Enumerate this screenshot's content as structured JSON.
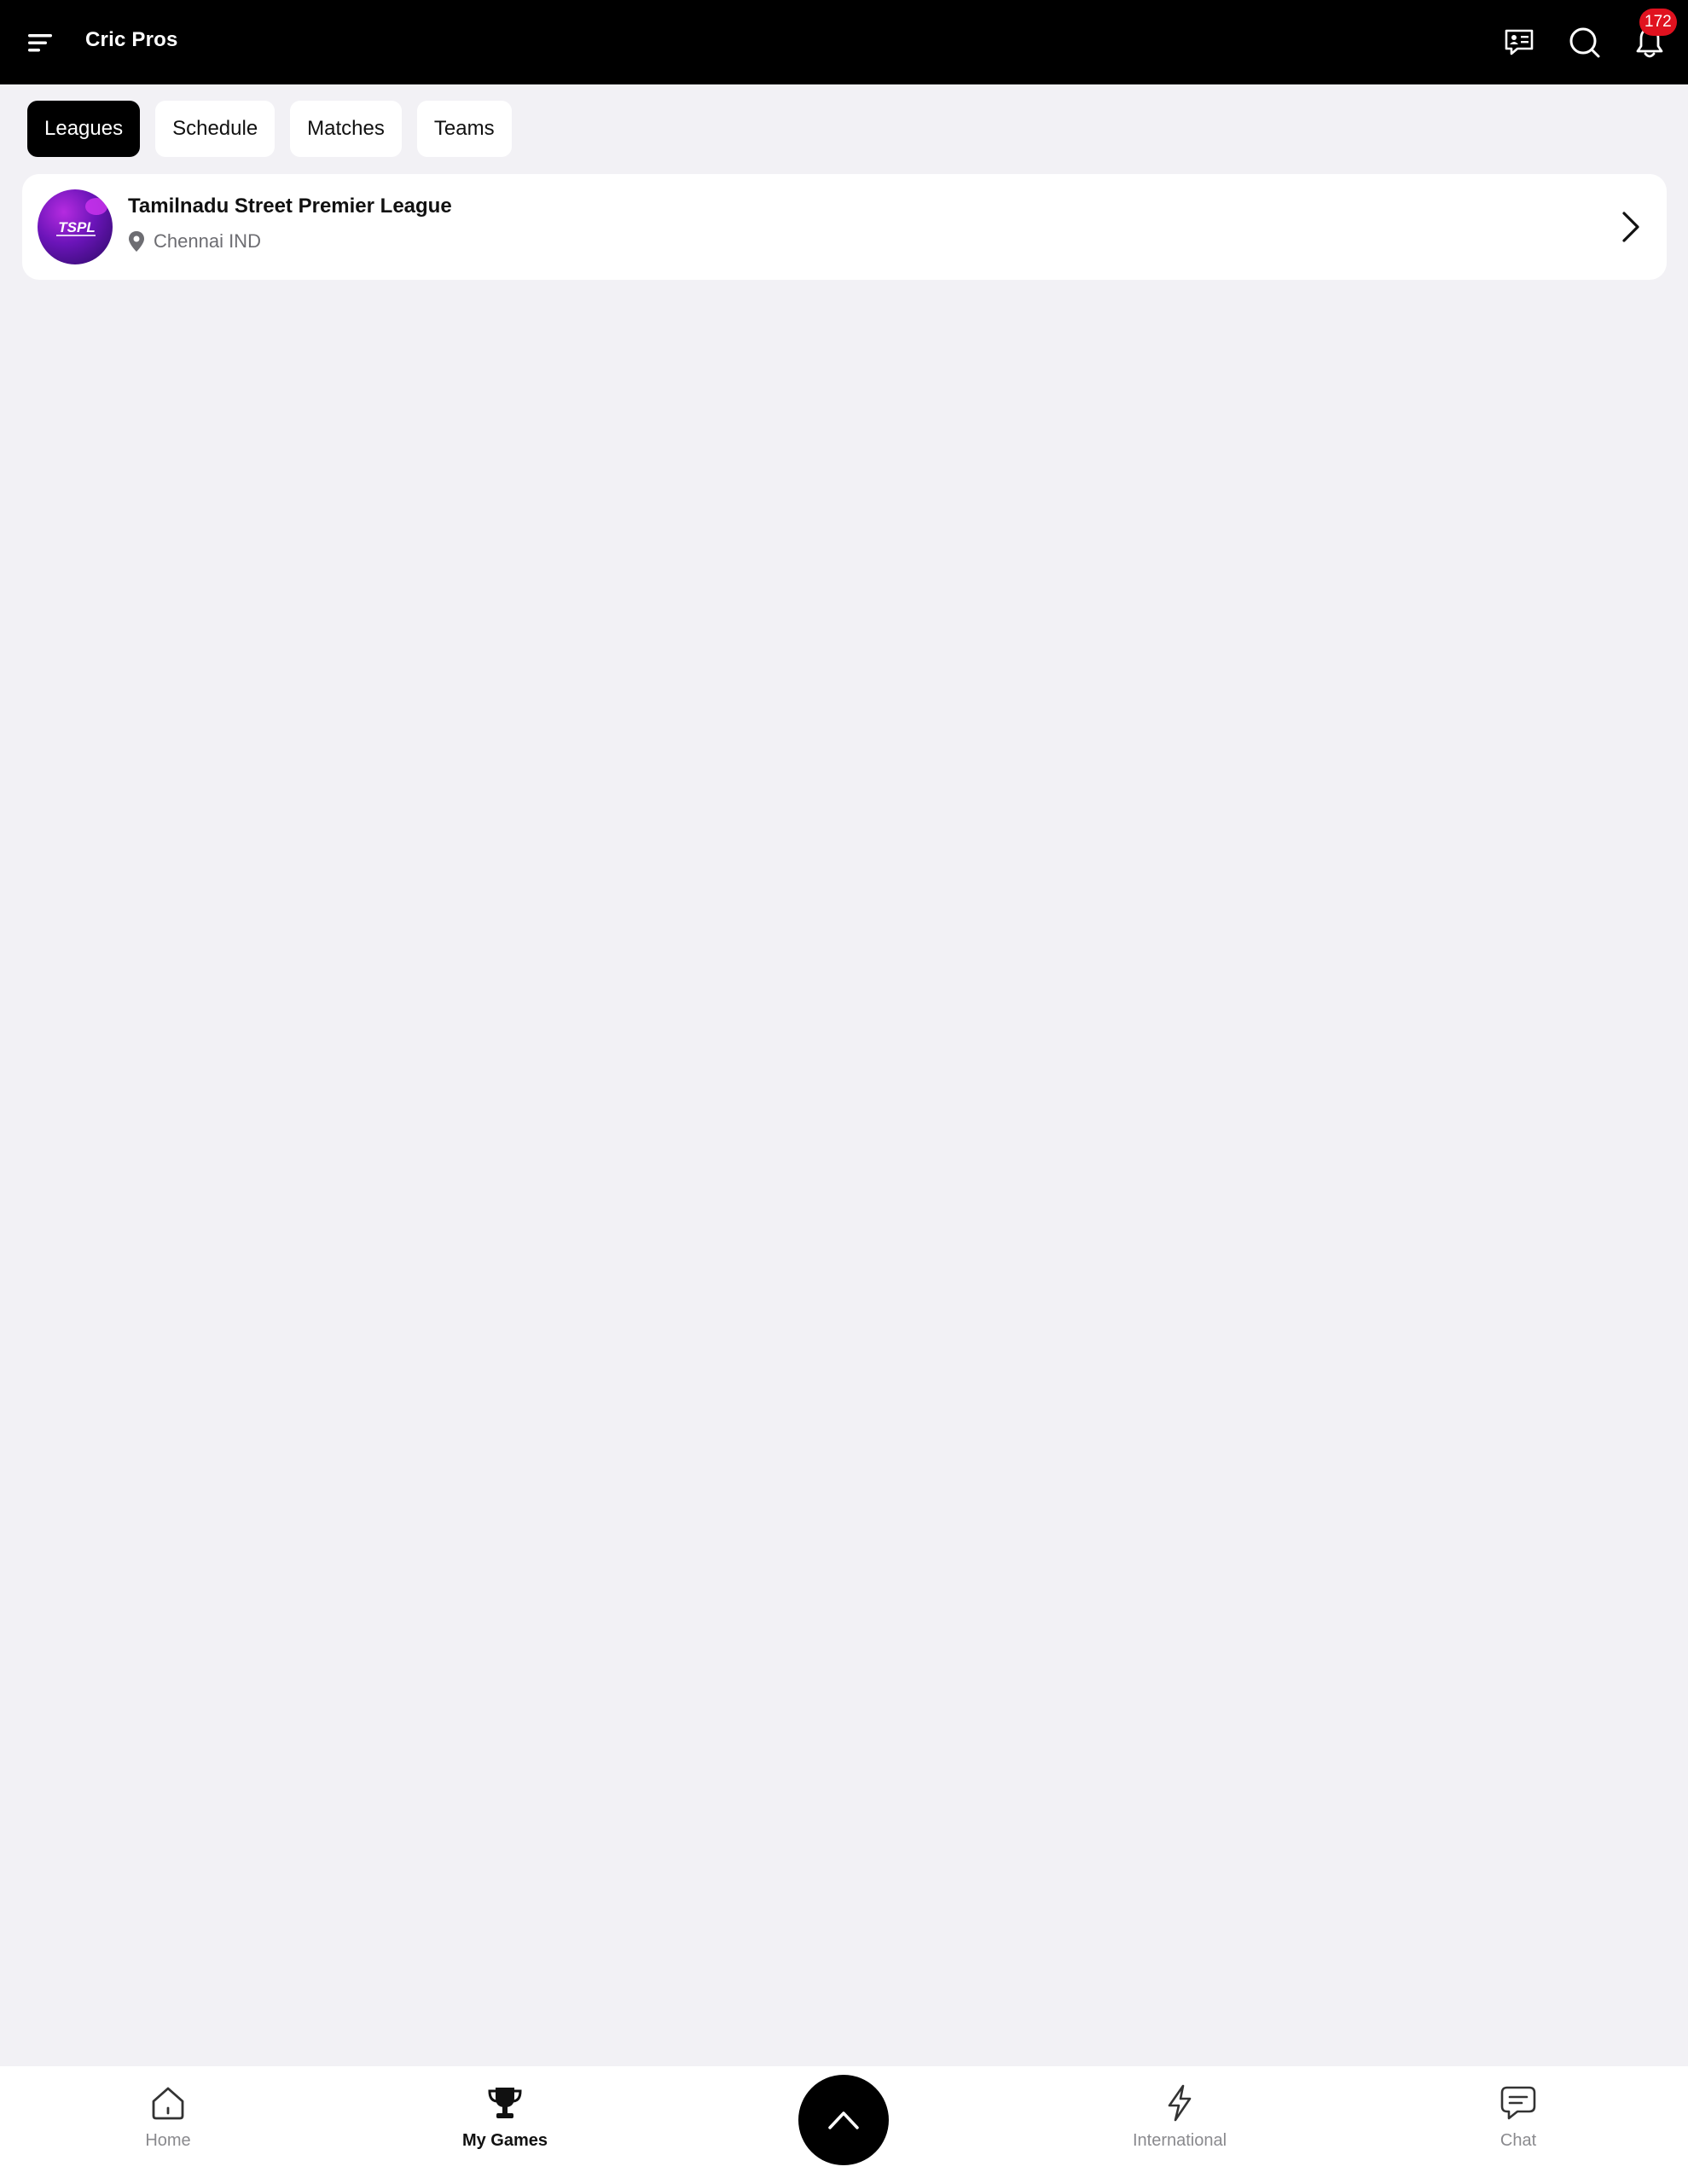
{
  "header": {
    "title": "Cric Pros",
    "notification_count": "172"
  },
  "tabs": [
    {
      "label": "Leagues",
      "active": true
    },
    {
      "label": "Schedule",
      "active": false
    },
    {
      "label": "Matches",
      "active": false
    },
    {
      "label": "Teams",
      "active": false
    }
  ],
  "leagues": [
    {
      "name": "Tamilnadu Street Premier League",
      "location": "Chennai IND",
      "logo_text": "TSPL"
    }
  ],
  "bottom_nav": {
    "home": "Home",
    "my_games": "My Games",
    "international": "International",
    "chat": "Chat"
  },
  "colors": {
    "header_bg": "#000000",
    "page_bg": "#f2f1f5",
    "badge": "#e0121f",
    "logo_purple": "#6a14b8"
  },
  "icons": [
    "menu-icon",
    "news-icon",
    "search-icon",
    "bell-icon",
    "location-pin-icon",
    "chevron-right-icon",
    "home-icon",
    "trophy-icon",
    "chevron-up-icon",
    "lightning-icon",
    "chat-icon"
  ]
}
